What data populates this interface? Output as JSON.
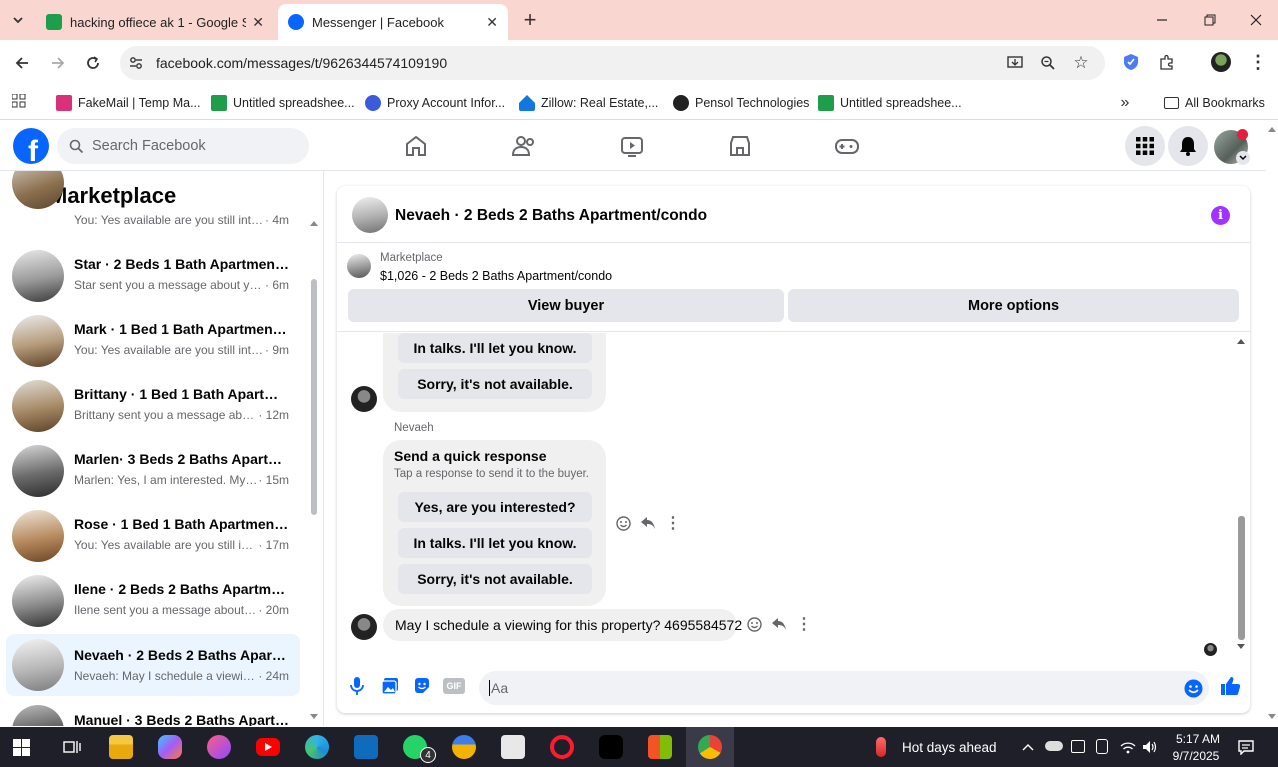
{
  "browser": {
    "tabs": [
      {
        "title": "hacking offiece ak 1 - Google S",
        "active": false
      },
      {
        "title": "Messenger | Facebook",
        "active": true
      }
    ],
    "url": "facebook.com/messages/t/9626344574109190",
    "bookmarks": [
      {
        "label": "FakeMail | Temp Ma..."
      },
      {
        "label": "Untitled spreadshee..."
      },
      {
        "label": "Proxy Account Infor..."
      },
      {
        "label": "Zillow: Real Estate,..."
      },
      {
        "label": "Pensol Technologies"
      },
      {
        "label": "Untitled spreadshee..."
      }
    ],
    "all_bookmarks": "All Bookmarks"
  },
  "facebook": {
    "logo": "f",
    "search_placeholder": "Search Facebook",
    "nav_icons": [
      "home-icon",
      "friends-icon",
      "video-icon",
      "marketplace-icon",
      "gaming-icon"
    ]
  },
  "sidebar": {
    "title": "Marketplace",
    "conversations": [
      {
        "name": "",
        "preview": "You: Yes available are you still inter...",
        "time": " · 4m"
      },
      {
        "name": "Star · 2 Beds 1 Bath Apartment/...",
        "preview": "Star sent you a message about yo...",
        "time": " · 6m"
      },
      {
        "name": "Mark · 1 Bed 1 Bath Apartment/...",
        "preview": "You: Yes available are you still inter...",
        "time": " · 9m"
      },
      {
        "name": "Brittany · 1 Bed 1 Bath Apartme...",
        "preview": "Brittany sent you a message abo...",
        "time": " · 12m"
      },
      {
        "name": "Marlen· 3 Beds 2 Baths Apartme...",
        "preview": "Marlen: Yes, I am interested. My ...",
        "time": " · 15m"
      },
      {
        "name": "Rose · 1 Bed 1 Bath Apartment/c...",
        "preview": "You: Yes available are you still int...",
        "time": " · 17m"
      },
      {
        "name": "Ilene · 2 Beds 2 Baths Apartmen...",
        "preview": "Ilene sent you a message about y...",
        "time": " · 20m"
      },
      {
        "name": "Nevaeh · 2 Beds 2 Baths Apartm...",
        "preview": "Nevaeh: May I schedule a viewin...",
        "time": " · 24m"
      },
      {
        "name": "Manuel · 3 Beds 2 Baths Apartm...",
        "preview": "",
        "time": ""
      }
    ]
  },
  "chat": {
    "title": "Nevaeh · 2 Beds 2 Baths Apartment/condo",
    "listing_source": "Marketplace",
    "listing_title": "$1,026 - 2 Beds 2 Baths Apartment/condo",
    "view_buyer": "View buyer",
    "more_options": "More options",
    "first_card": {
      "responses": [
        "In talks. I'll let you know.",
        "Sorry, it's not available."
      ]
    },
    "sender": "Nevaeh",
    "second_card": {
      "title": "Send a quick response",
      "subtitle": "Tap a response to send it to the buyer.",
      "responses": [
        "Yes, are you interested?",
        "In talks. I'll let you know.",
        "Sorry, it's not available."
      ]
    },
    "message": "May I schedule a viewing for this property? 4695584572",
    "composer_placeholder": "Aa"
  },
  "taskbar": {
    "weather": "Hot days ahead",
    "time": "5:17 AM",
    "date": "9/7/2025",
    "whatsapp_badge": "4"
  },
  "colors": {
    "fb_blue": "#0866ff",
    "tabbar": "#f9d6cf",
    "messenger_purple": "#a033ff"
  }
}
